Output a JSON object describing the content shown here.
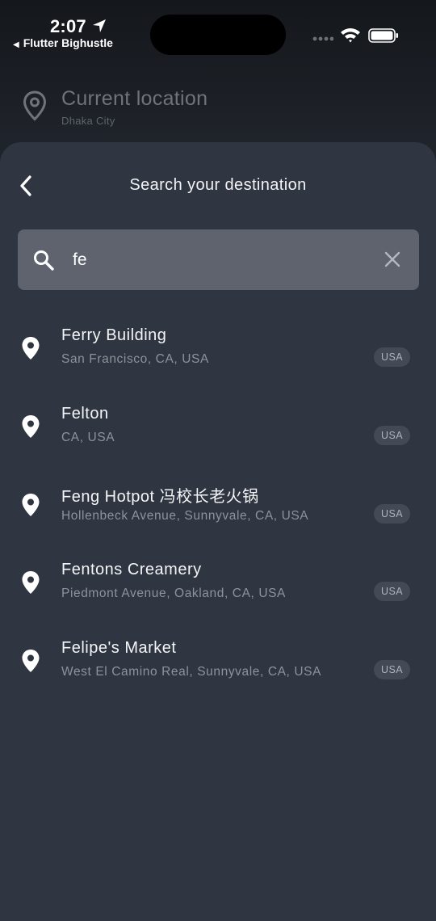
{
  "status_bar": {
    "time": "2:07",
    "back_app": "Flutter Bighustle"
  },
  "current_location": {
    "title": "Current location",
    "city": "Dhaka City"
  },
  "sheet": {
    "title": "Search your destination"
  },
  "search": {
    "value": "fe",
    "placeholder": ""
  },
  "results": [
    {
      "name": "Ferry Building",
      "address": "San Francisco, CA, USA",
      "country": "USA"
    },
    {
      "name": "Felton",
      "address": "CA, USA",
      "country": "USA"
    },
    {
      "name": "Feng Hotpot 冯校长老火锅",
      "address": "Hollenbeck Avenue, Sunnyvale, CA, USA",
      "country": "USA"
    },
    {
      "name": "Fentons Creamery",
      "address": "Piedmont Avenue, Oakland, CA, USA",
      "country": "USA"
    },
    {
      "name": "Felipe's Market",
      "address": "West El Camino Real, Sunnyvale, CA, USA",
      "country": "USA"
    }
  ],
  "icons": {
    "back": "chevron-left-icon",
    "search": "search-icon",
    "clear": "close-icon",
    "pin": "location-pin-icon"
  },
  "colors": {
    "sheet_bg": "#2f3541",
    "search_bg": "#5e636e",
    "badge_bg": "#434955"
  }
}
